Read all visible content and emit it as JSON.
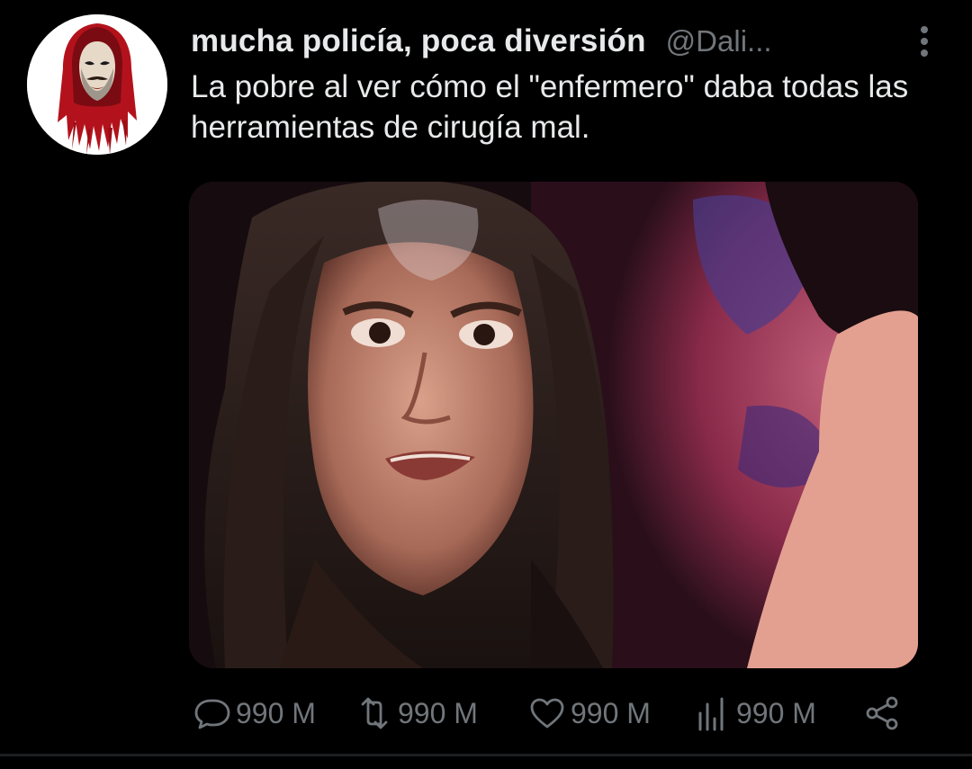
{
  "tweet": {
    "author": {
      "display_name": "mucha policía, poca diversión",
      "handle": "@Dali..."
    },
    "text": "La pobre al ver cómo el \"enfermero\" daba todas las herramientas de cirugía mal.",
    "actions": {
      "reply": {
        "icon": "comment-icon",
        "count": "990 M"
      },
      "retweet": {
        "icon": "retweet-icon",
        "count": "990 M"
      },
      "like": {
        "icon": "heart-icon",
        "count": "990 M"
      },
      "views": {
        "icon": "bar-chart-icon",
        "count": "990 M"
      },
      "share": {
        "icon": "share-icon"
      }
    },
    "more_icon": "vertical-dots-icon",
    "media": {
      "kind": "photo"
    }
  },
  "colors": {
    "background": "#000000",
    "primary_text": "#e7e9ea",
    "secondary_text": "#71767b",
    "avatar_accent": "#b3121c"
  }
}
